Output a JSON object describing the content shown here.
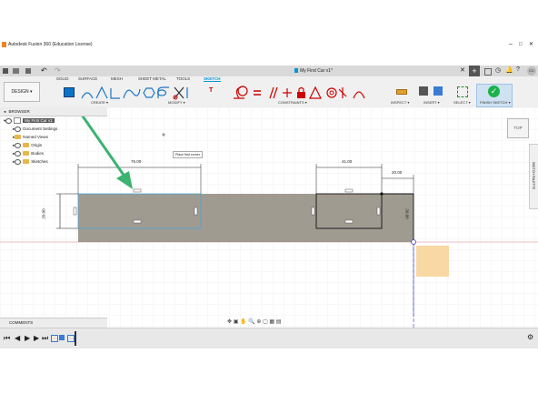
{
  "window": {
    "title": "Autodesk Fusion 360 (Education License)",
    "doc_tab": "My First Car v1*"
  },
  "toolbar": {
    "design_button": "DESIGN",
    "tabs": [
      "SOLID",
      "SURFACE",
      "MESH",
      "SHEET METAL",
      "TOOLS",
      "SKETCH"
    ],
    "groups": {
      "create": "CREATE",
      "modify": "MODIFY",
      "constraints": "CONSTRAINTS",
      "inspect": "INSPECT",
      "insert": "INSERT",
      "select": "SELECT",
      "finish": "FINISH SKETCH"
    }
  },
  "browser": {
    "title": "BROWSER",
    "root": "My First Car v1",
    "items": [
      "Document Settings",
      "Named Views",
      "Origin",
      "Bodies",
      "Sketches"
    ]
  },
  "comments": {
    "title": "COMMENTS"
  },
  "canvas": {
    "tooltip": "Place first corner",
    "viewcube_face": "TOP",
    "sketch_palette": "SKETCH PALETTE",
    "dimensions": {
      "d1": "76.00",
      "d2": "41.00",
      "d3": "20.00",
      "d4": "20.00",
      "d5": "20.00"
    }
  },
  "colors": {
    "accent": "#0696d7",
    "annotation": "#3cb371",
    "body": "#8f8a7e",
    "finish": "#19b24b",
    "plane": "#f8d49a"
  },
  "icons": {
    "home": "home-icon",
    "save": "save-icon",
    "undo": "undo-icon",
    "redo": "redo-icon",
    "rectangle": "rectangle-icon",
    "line": "line-icon",
    "circle": "circle-icon",
    "arc": "arc-icon",
    "polygon": "polygon-icon",
    "ellipse": "ellipse-icon",
    "trim": "trim-icon",
    "lock": "lock-icon",
    "finish": "checkmark-icon"
  }
}
